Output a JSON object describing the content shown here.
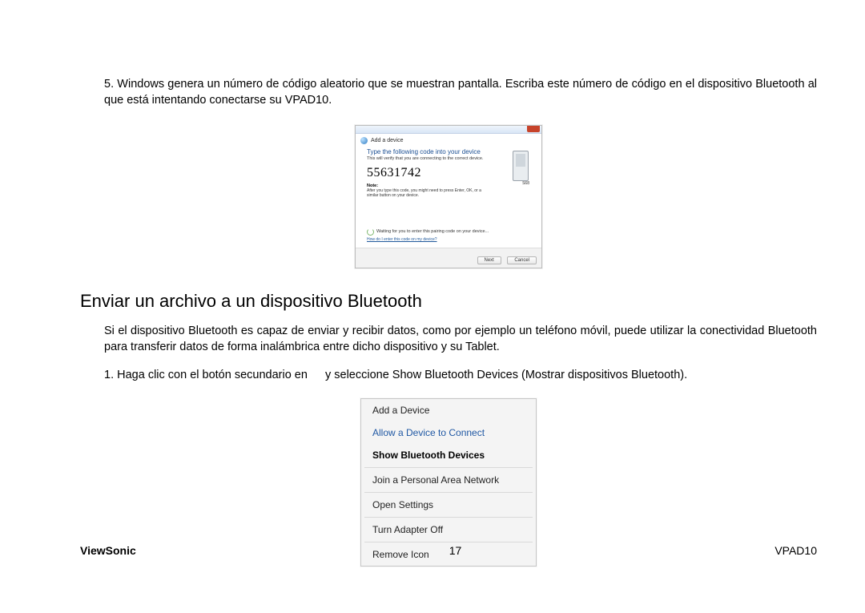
{
  "para5": "5. Windows genera un número de código aleatorio que se muestran pantalla. Escriba este número de código en el dispositivo Bluetooth al que está intentando conectarse su VPAD10.",
  "dialog": {
    "crumb_icon_label": "device-wizard-icon",
    "crumb_text": "Add a device",
    "heading": "Type the following code into your device",
    "sub": "This will verify that you are connecting to the correct device.",
    "code": "55631742",
    "note_label": "Note:",
    "note_text": "After you type this code, you might need to press Enter, OK, or a similar button on your device.",
    "phone_label": "S68",
    "status": "Waiting for you to enter this pairing code on your device...",
    "help_link": "How do I enter this code on my device?",
    "btn_next": "Next",
    "btn_cancel": "Cancel"
  },
  "section_title": "Enviar un archivo a un dispositivo Bluetooth",
  "para_intro": "Si el dispositivo Bluetooth es capaz de enviar y recibir datos, como por ejemplo un teléfono móvil, puede utilizar la conectividad Bluetooth para transferir datos de forma inalámbrica entre dicho dispositivo y su Tablet.",
  "step1_a": "1. Haga clic con el botón secundario en ",
  "step1_b": " y seleccione Show Bluetooth Devices (Mostrar dispositivos Bluetooth).",
  "menu": {
    "items": [
      {
        "label": "Add a Device",
        "style": "normal"
      },
      {
        "label": "Allow a Device to Connect",
        "style": "link"
      },
      {
        "label": "Show Bluetooth Devices",
        "style": "bold"
      },
      {
        "label": "Join a Personal Area Network",
        "style": "normal",
        "sep_before": true
      },
      {
        "label": "Open Settings",
        "style": "normal",
        "sep_before": true
      },
      {
        "label": "Turn Adapter Off",
        "style": "normal",
        "sep_before": true
      },
      {
        "label": "Remove Icon",
        "style": "normal",
        "sep_before": true
      }
    ]
  },
  "footer": {
    "brand": "ViewSonic",
    "page": "17",
    "model": "VPAD10"
  }
}
